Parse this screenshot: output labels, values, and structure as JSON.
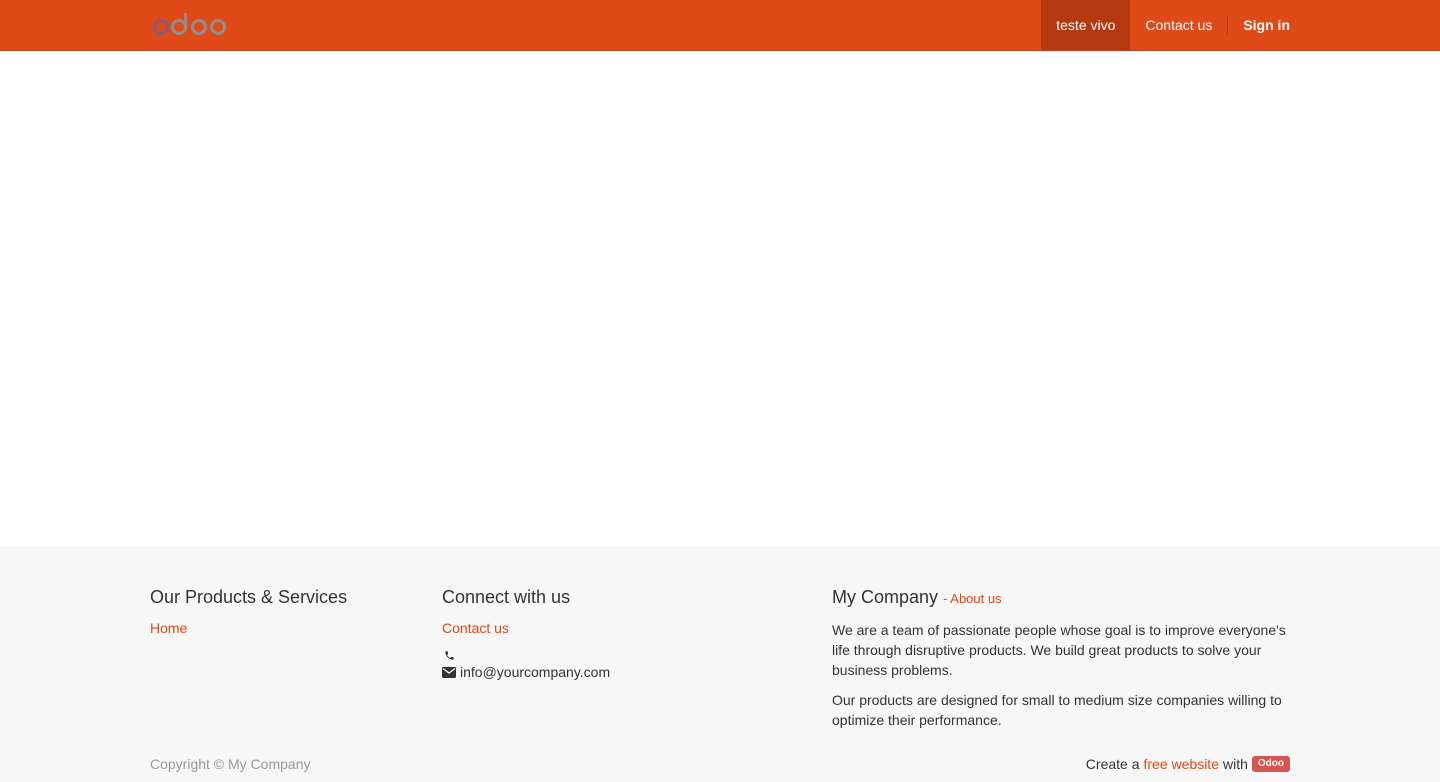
{
  "logo": {
    "alt": "odoo",
    "colors": [
      "#875a7b",
      "#8f8f8f"
    ]
  },
  "navbar": {
    "items": [
      {
        "label": "teste vivo",
        "active": true
      },
      {
        "label": "Contact us",
        "active": false
      }
    ],
    "signin_label": "Sign in",
    "bg_color": "#df4a18"
  },
  "footer": {
    "col1": {
      "title": "Our Products & Services",
      "links": [
        "Home"
      ]
    },
    "col2": {
      "title": "Connect with us",
      "contact_link": "Contact us",
      "phone": "",
      "email": "info@yourcompany.com",
      "phone_icon": "phone-icon",
      "email_icon": "envelope-icon"
    },
    "col3": {
      "title": "My Company",
      "about_link": "- About us",
      "para1": "We are a team of passionate people whose goal is to improve everyone's life through disruptive products. We build great products to solve your business problems.",
      "para2": "Our products are designed for small to medium size companies willing to optimize their performance."
    },
    "copyright": "Copyright © My Company",
    "powered": {
      "prefix": "Create a",
      "link": "free website",
      "with": "with",
      "badge": "Odoo"
    }
  }
}
